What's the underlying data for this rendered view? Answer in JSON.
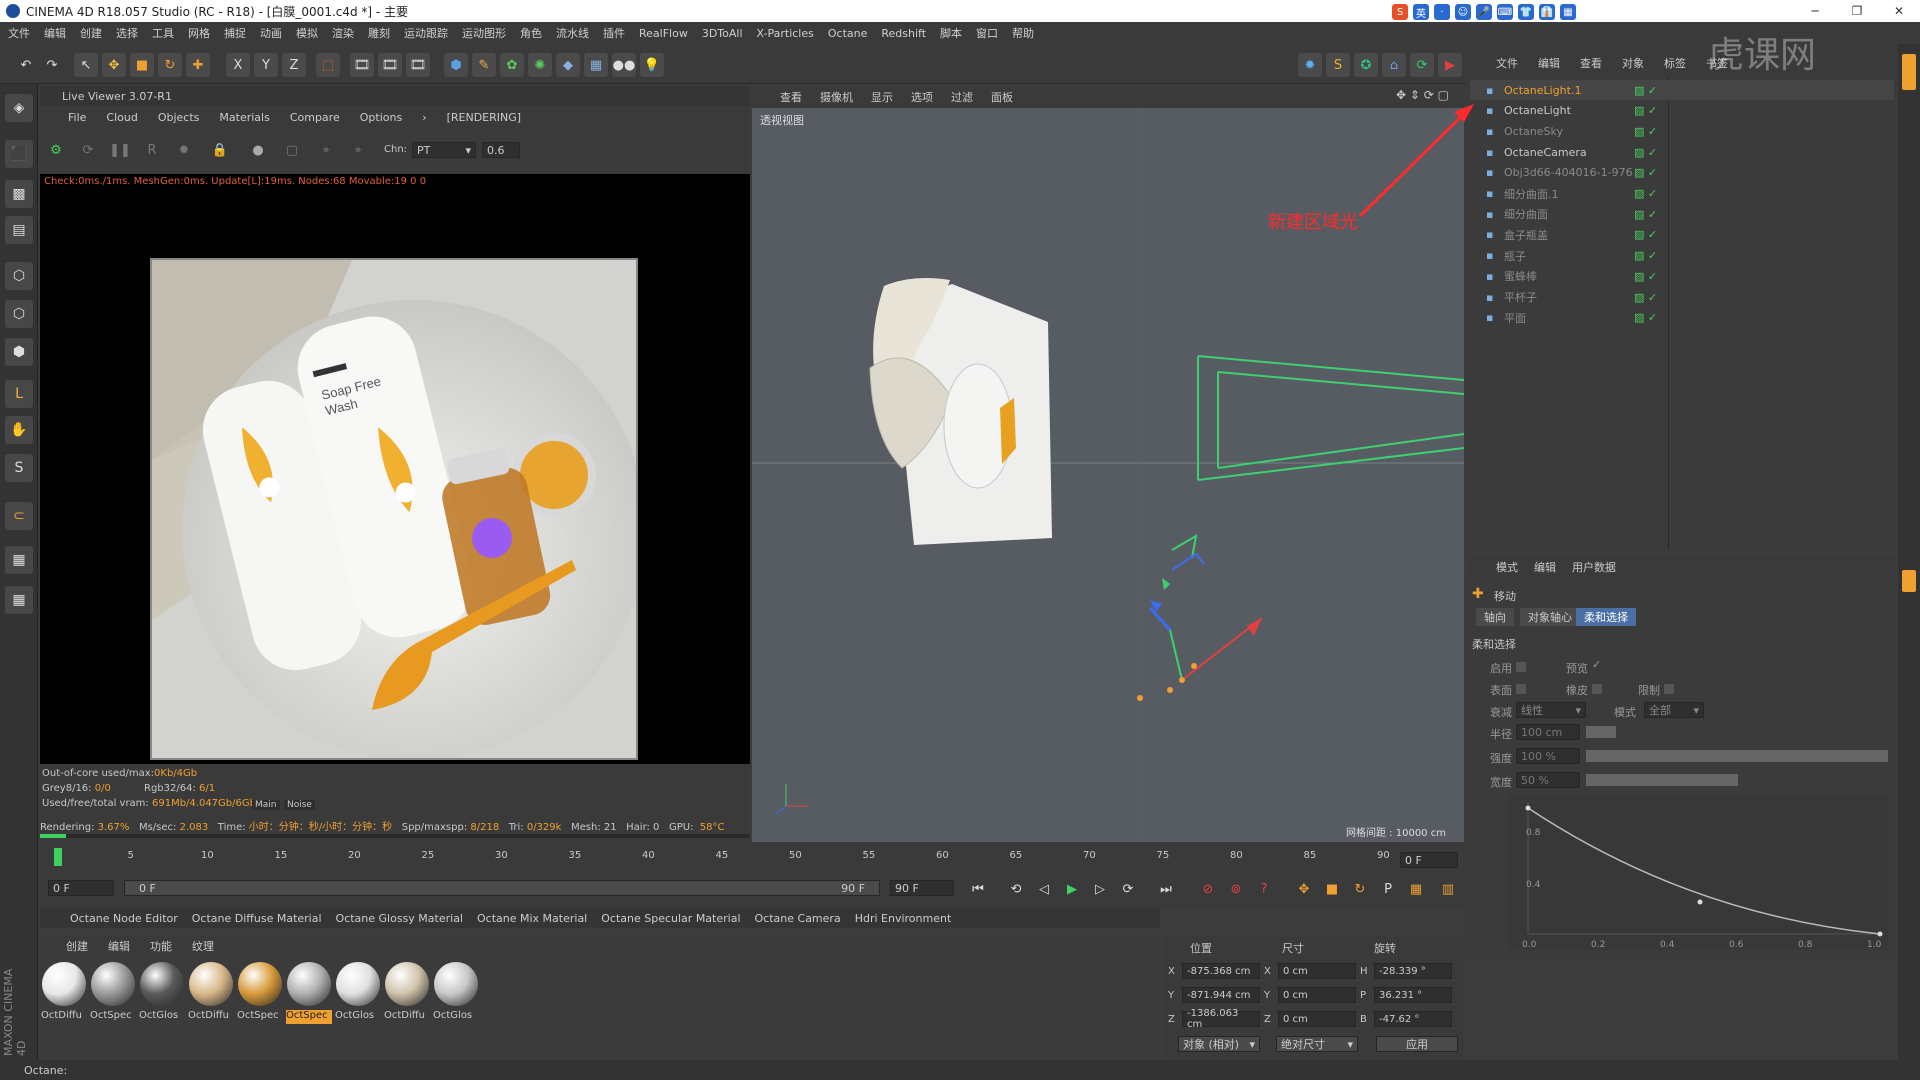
{
  "window": {
    "title": "CINEMA 4D R18.057 Studio (RC - R18) - [白膜_0001.c4d *] - 主要",
    "ime": [
      "S",
      "英",
      "·",
      "☺",
      "🎤",
      "⌨",
      "👕",
      "👔",
      "▦"
    ]
  },
  "menubar": [
    "文件",
    "编辑",
    "创建",
    "选择",
    "工具",
    "网格",
    "捕捉",
    "动画",
    "模拟",
    "渲染",
    "雕刻",
    "运动跟踪",
    "运动图形",
    "角色",
    "流水线",
    "插件",
    "RealFlow",
    "3DToAll",
    "X-Particles",
    "Octane",
    "Redshift",
    "脚本",
    "窗口",
    "帮助"
  ],
  "toolbar": {
    "axis_x": "X",
    "axis_y": "Y",
    "axis_z": "Z"
  },
  "live_viewer": {
    "title": "Live Viewer 3.07-R1",
    "menu": [
      "File",
      "Cloud",
      "Objects",
      "Materials",
      "Compare",
      "Options"
    ],
    "rendering": "[RENDERING]",
    "chn_label": "Chn:",
    "chn_value": "PT",
    "chn_number": "0.6",
    "check_line": "Check:0ms./1ms. MeshGen:0ms. Update[L]:19ms. Nodes:68 Movable:19 0 0",
    "render_text1": "Soap Free",
    "render_text2": "Wash",
    "stats": {
      "ooc": "Out-of-core used/max:",
      "ooc_val": "0Kb/4Gb",
      "grey": "Grey8/16: ",
      "grey_val": "0/0",
      "rgb": "Rgb32/64: ",
      "rgb_val": "6/1",
      "vram": "Used/free/total vram: ",
      "vram_val": "691Mb/4.047Gb/6Gb",
      "tab_main": "Main",
      "tab_noise": "Noise",
      "rendering": "Rendering: ",
      "rendering_val": "3.67%",
      "mssec": "Ms/sec: ",
      "mssec_val": "2.083",
      "time": "Time: ",
      "time_val": "小时：分钟：秒/小时：分钟：秒",
      "spp": "Spp/maxspp: ",
      "spp_val": "8/218",
      "tri": "Tri: ",
      "tri_val": "0/329k",
      "mesh": "Mesh: 21",
      "hair": "Hair: 0",
      "gpu": "GPU:",
      "gpu_temp": "58°C",
      "progress": 0.0367
    }
  },
  "viewport": {
    "menu": [
      "查看",
      "摄像机",
      "显示",
      "选项",
      "过滤",
      "面板"
    ],
    "label": "透视视图",
    "grid": "网格间距 : 10000 cm"
  },
  "timeline": {
    "ticks": [
      "0",
      "5",
      "10",
      "15",
      "20",
      "25",
      "30",
      "35",
      "40",
      "45",
      "50",
      "55",
      "60",
      "65",
      "70",
      "75",
      "80",
      "85",
      "90"
    ],
    "current": "0 F",
    "start": "0 F",
    "range_start": "0 F",
    "range_end": "90 F",
    "end": "90 F"
  },
  "material_bar": [
    "Octane Node Editor",
    "Octane Diffuse Material",
    "Octane Glossy Material",
    "Octane Mix Material",
    "Octane Specular Material",
    "Octane Camera",
    "Hdri Environment"
  ],
  "materials": {
    "menu": [
      "创建",
      "编辑",
      "功能",
      "纹理"
    ],
    "items": [
      {
        "label": "OctDiffu",
        "color": "#e8e8e8"
      },
      {
        "label": "OctSpec",
        "color": "#9a9a9a"
      },
      {
        "label": "OctGlos",
        "color": "#5a5a5a"
      },
      {
        "label": "OctDiffu",
        "color": "#d8b88a"
      },
      {
        "label": "OctSpec",
        "color": "#d89a3a"
      },
      {
        "label": "OctSpec",
        "color": "#b0b0b0"
      },
      {
        "label": "OctGlos",
        "color": "#e0e0e0"
      },
      {
        "label": "OctDiffu",
        "color": "#cfc2aa"
      },
      {
        "label": "OctGlos",
        "color": "#c8c8c8"
      }
    ],
    "selected_index": 5
  },
  "coords": {
    "headers": [
      "位置",
      "尺寸",
      "旋转"
    ],
    "x": {
      "label": "X",
      "pos": "-875.368 cm",
      "size_label": "X",
      "size": "0 cm",
      "rot_label": "H",
      "rot": "-28.339 °"
    },
    "y": {
      "label": "Y",
      "pos": "-871.944 cm",
      "size_label": "Y",
      "size": "0 cm",
      "rot_label": "P",
      "rot": "36.231 °"
    },
    "z": {
      "label": "Z",
      "pos": "-1386.063 cm",
      "size_label": "Z",
      "size": "0 cm",
      "rot_label": "B",
      "rot": "-47.62 °"
    },
    "mode": "对象 (相对)",
    "size_mode": "绝对尺寸",
    "apply": "应用"
  },
  "objects": {
    "menu": [
      "文件",
      "编辑",
      "查看",
      "对象",
      "标签",
      "书签"
    ],
    "rows": [
      {
        "name": "OctaneLight.1",
        "selected": true,
        "color": "#f0a030"
      },
      {
        "name": "OctaneLight",
        "selected": false,
        "color": "#c8c8c8"
      },
      {
        "name": "OctaneSky",
        "selected": false,
        "color": "#8a8a8a"
      },
      {
        "name": "OctaneCamera",
        "selected": false,
        "color": "#c8c8c8"
      },
      {
        "name": "Obj3d66-404016-1-976",
        "selected": false,
        "color": "#8a8a8a"
      },
      {
        "name": "细分曲面.1",
        "selected": false,
        "color": "#8a8a8a"
      },
      {
        "name": "细分曲面",
        "selected": false,
        "color": "#8a8a8a"
      },
      {
        "name": "盒子瓶盖",
        "selected": false,
        "color": "#8a8a8a"
      },
      {
        "name": "瓶子",
        "selected": false,
        "color": "#8a8a8a"
      },
      {
        "name": "蜜蜂棒",
        "selected": false,
        "color": "#8a8a8a"
      },
      {
        "name": "平杯子",
        "selected": false,
        "color": "#8a8a8a"
      },
      {
        "name": "平面",
        "selected": false,
        "color": "#8a8a8a"
      }
    ]
  },
  "annotation": "新建区域光",
  "attributes": {
    "menu": [
      "模式",
      "编辑",
      "用户数据"
    ],
    "title": "移动",
    "tabs": [
      "轴向",
      "对象轴心",
      "柔和选择"
    ],
    "active_tab": 2,
    "section": "柔和选择",
    "enable": "启用",
    "preview": "预览",
    "surface": "表面",
    "rubber": "橡皮",
    "limit": "限制",
    "falloff": "衰减",
    "falloff_val": "线性",
    "mode": "模式",
    "mode_val": "全部",
    "radius": "半径",
    "radius_val": "100 cm",
    "strength": "强度",
    "strength_val": "100 %",
    "width": "宽度",
    "width_val": "50 %",
    "graph_y": [
      "0.8",
      "0.4"
    ],
    "graph_x": [
      "0.0",
      "0.2",
      "0.4",
      "0.6",
      "0.8",
      "1.0"
    ]
  },
  "statusbar": "Octane:",
  "watermark": "虎课网"
}
